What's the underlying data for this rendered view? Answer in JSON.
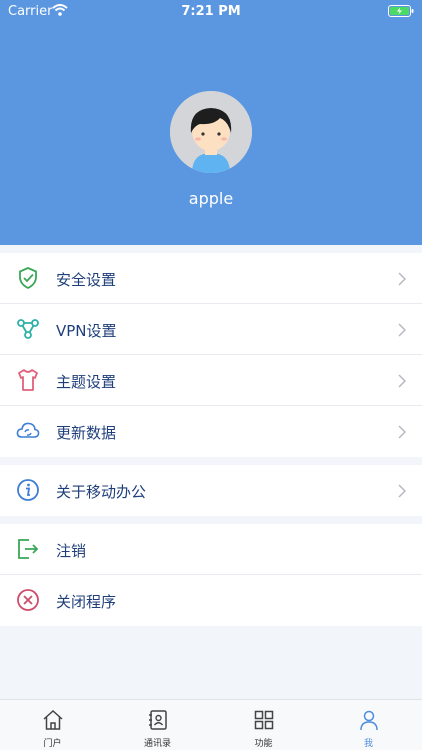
{
  "status_bar": {
    "carrier": "Carrier",
    "time": "7:21 PM"
  },
  "profile": {
    "username": "apple"
  },
  "menu_group_1": [
    {
      "label": "安全设置",
      "icon": "shield-check-icon"
    },
    {
      "label": "VPN设置",
      "icon": "vpn-nodes-icon"
    },
    {
      "label": "主题设置",
      "icon": "shirt-icon"
    },
    {
      "label": "更新数据",
      "icon": "cloud-sync-icon"
    }
  ],
  "menu_group_2": [
    {
      "label": "关于移动办公",
      "icon": "info-icon"
    }
  ],
  "menu_group_3": [
    {
      "label": "注销",
      "icon": "logout-icon"
    },
    {
      "label": "关闭程序",
      "icon": "close-circle-icon"
    }
  ],
  "tabs": [
    {
      "label": "门户",
      "icon": "home-icon"
    },
    {
      "label": "通讯录",
      "icon": "contacts-icon"
    },
    {
      "label": "功能",
      "icon": "grid-icon"
    },
    {
      "label": "我",
      "icon": "person-icon",
      "active": true
    }
  ],
  "colors": {
    "header": "#5b97e1",
    "accent": "#4d8ddf",
    "label": "#1f3f7a"
  }
}
